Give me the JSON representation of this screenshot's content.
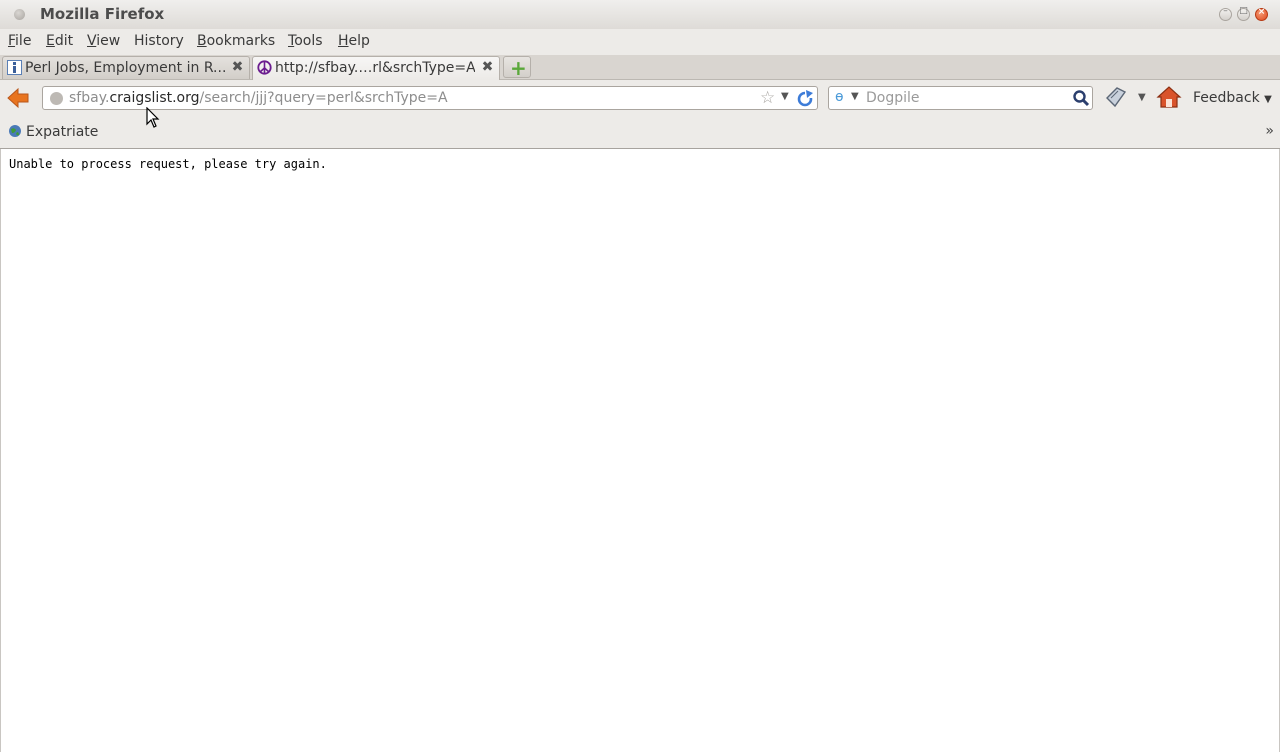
{
  "window": {
    "title": "Mozilla Firefox",
    "controls": [
      "minimize",
      "maximize",
      "close"
    ]
  },
  "menubar": {
    "items": [
      {
        "label": "File",
        "accel": "F",
        "rest": "ile"
      },
      {
        "label": "Edit",
        "accel": "E",
        "rest": "dit"
      },
      {
        "label": "View",
        "accel": "V",
        "rest": "iew"
      },
      {
        "label": "History",
        "accel": "",
        "rest": "History"
      },
      {
        "label": "Bookmarks",
        "accel": "B",
        "rest": "ookmarks"
      },
      {
        "label": "Tools",
        "accel": "T",
        "rest": "ools"
      },
      {
        "label": "Help",
        "accel": "H",
        "rest": "elp"
      }
    ]
  },
  "tabs": [
    {
      "label": "Perl Jobs, Employment in R...",
      "icon": "info-icon",
      "active": false
    },
    {
      "label": "http://sfbay.…rl&srchType=A",
      "icon": "peace-icon",
      "active": true
    }
  ],
  "navbar": {
    "url_prefix": "sfbay.",
    "url_host": "craigslist.org",
    "url_path": "/search/jjj?query=perl&srchType=A",
    "search_engine": "Dogpile",
    "feedback_label": "Feedback"
  },
  "bookmarks": {
    "items": [
      {
        "label": "Expatriate",
        "icon": "globe-icon"
      }
    ]
  },
  "content": {
    "message": "Unable to process request, please try again."
  },
  "colors": {
    "toolbar_bg": "#edebe8",
    "close_button": "#df4a1f",
    "reload": "#3d7cd8",
    "new_tab_plus": "#5aa83a",
    "back_arrow": "#e8741f"
  }
}
